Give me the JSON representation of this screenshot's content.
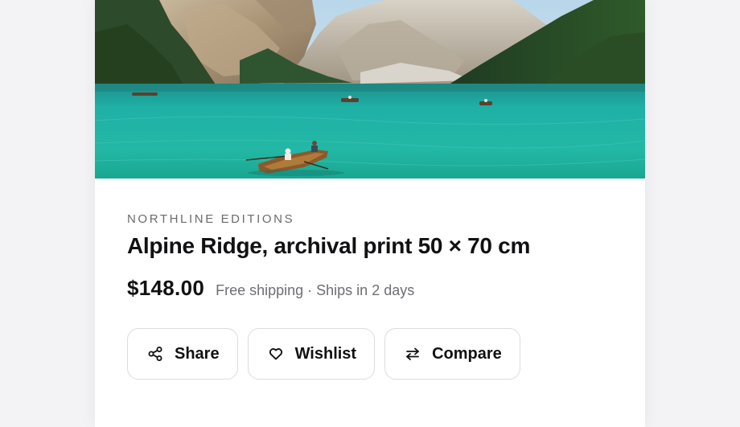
{
  "product": {
    "brand": "NORTHLINE EDITIONS",
    "title": "Alpine Ridge, archival print 50 × 70 cm",
    "price": "$148.00",
    "shipping": "Free shipping · Ships in 2 days"
  },
  "actions": [
    {
      "label": "Share",
      "icon": "share-icon"
    },
    {
      "label": "Wishlist",
      "icon": "heart-icon"
    },
    {
      "label": "Compare",
      "icon": "compare-arrows-icon"
    }
  ],
  "colors": {
    "page_background": "#f3f3f5",
    "card_background": "#ffffff",
    "text_primary": "#111113",
    "text_secondary": "#6e6e73",
    "button_border": "#dcdce0",
    "lake_turquoise": "#1fb5a8"
  }
}
